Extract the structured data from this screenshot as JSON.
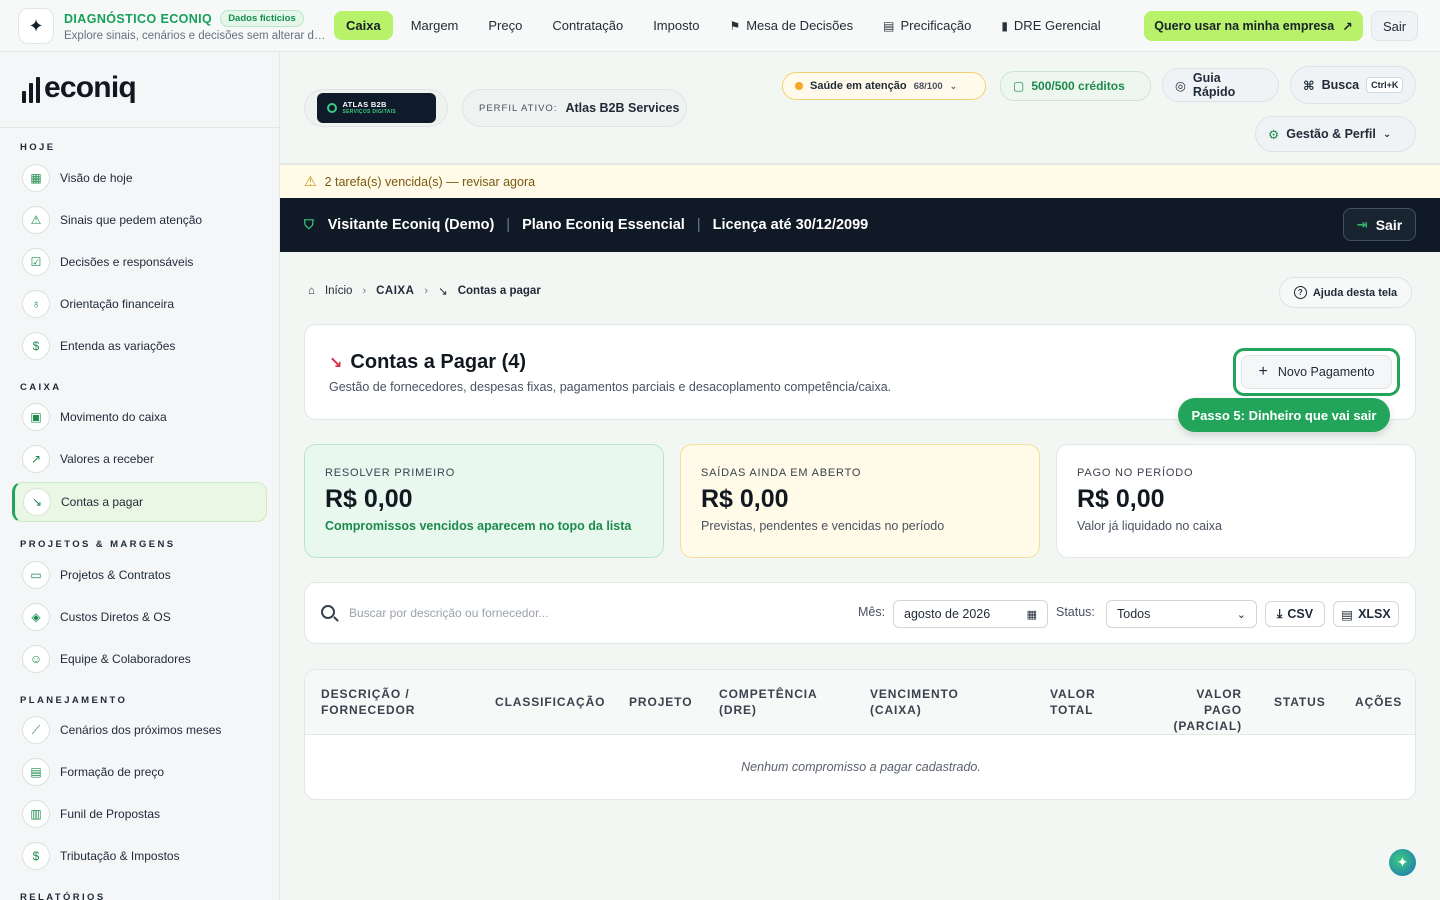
{
  "topbar": {
    "brand_icon": "sparkle-icon",
    "brand_title": "DIAGNÓSTICO ECONIQ",
    "brand_badge": "Dados fictícios",
    "brand_subtitle": "Explore sinais, cenários e decisões sem alterar dados reais",
    "nav": [
      {
        "label": "Caixa",
        "active": true
      },
      {
        "label": "Margem"
      },
      {
        "label": "Preço"
      },
      {
        "label": "Contratação"
      },
      {
        "label": "Imposto"
      },
      {
        "label": "Mesa de Decisões",
        "icon": "flag-icon"
      },
      {
        "label": "Precificação",
        "icon": "calculator-icon"
      },
      {
        "label": "DRE Gerencial",
        "icon": "file-icon"
      }
    ],
    "cta_label": "Quero usar na minha empresa",
    "exit_label": "Sair",
    "accent_color": "#b8f26b"
  },
  "sidebar": {
    "logo_text": "econiq",
    "sections": [
      {
        "label": "HOJE",
        "items": [
          {
            "label": "Visão de hoje",
            "icon": "grid-icon"
          },
          {
            "label": "Sinais que pedem atenção",
            "icon": "warning-icon"
          },
          {
            "label": "Decisões e responsáveis",
            "icon": "check-square-icon"
          },
          {
            "label": "Orientação financeira",
            "icon": "lightbulb-icon"
          },
          {
            "label": "Entenda as variações",
            "icon": "file-dollar-icon"
          }
        ]
      },
      {
        "label": "CAIXA",
        "items": [
          {
            "label": "Movimento do caixa",
            "icon": "wallet-icon"
          },
          {
            "label": "Valores a receber",
            "icon": "trend-up-icon"
          },
          {
            "label": "Contas a pagar",
            "icon": "trend-down-icon",
            "active": true
          }
        ]
      },
      {
        "label": "PROJETOS & MARGENS",
        "items": [
          {
            "label": "Projetos & Contratos",
            "icon": "folder-icon"
          },
          {
            "label": "Custos Diretos & OS",
            "icon": "box-icon"
          },
          {
            "label": "Equipe & Colaboradores",
            "icon": "user-plus-icon"
          }
        ]
      },
      {
        "label": "PLANEJAMENTO",
        "items": [
          {
            "label": "Cenários dos próximos meses",
            "icon": "line-chart-icon"
          },
          {
            "label": "Formação de preço",
            "icon": "calculator-icon"
          },
          {
            "label": "Funil de Propostas",
            "icon": "funnel-icon"
          },
          {
            "label": "Tributação & Impostos",
            "icon": "dollar-doc-icon"
          }
        ]
      },
      {
        "label": "RELATÓRIOS",
        "items": []
      }
    ]
  },
  "header": {
    "org_logo_line1": "ATLAS B2B",
    "org_logo_line2": "SERVIÇOS DIGITAIS",
    "profile_key": "PERFIL ATIVO:",
    "profile_value": "Atlas B2B Services",
    "health_label": "Saúde em atenção",
    "health_score": "68/100",
    "credits_label": "500/500 créditos",
    "guide_label": "Guia Rápido",
    "search_label": "Busca",
    "search_shortcut": "Ctrl+K",
    "manage_label": "Gestão & Perfil"
  },
  "alert": {
    "text": "2 tarefa(s) vencida(s) — revisar agora"
  },
  "license_bar": {
    "user": "Visitante Econiq (Demo)",
    "plan": "Plano Econiq Essencial",
    "license": "Licença até 30/12/2099",
    "exit_label": "Sair"
  },
  "breadcrumb": {
    "home": "Início",
    "section": "CAIXA",
    "current": "Contas a pagar"
  },
  "help_label": "Ajuda desta tela",
  "page": {
    "title": "Contas a Pagar (4)",
    "subtitle": "Gestão de fornecedores, despesas fixas, pagamentos parciais e desacoplamento competência/caixa.",
    "new_button": "Novo Pagamento",
    "tour_step": "Passo 5: Dinheiro que vai sair"
  },
  "kpis": [
    {
      "label": "RESOLVER PRIMEIRO",
      "value": "R$ 0,00",
      "note": "Compromissos vencidos aparecem no topo da lista"
    },
    {
      "label": "SAÍDAS AINDA EM ABERTO",
      "value": "R$ 0,00",
      "note": "Previstas, pendentes e vencidas no período"
    },
    {
      "label": "PAGO NO PERÍODO",
      "value": "R$ 0,00",
      "note": "Valor já liquidado no caixa"
    }
  ],
  "filters": {
    "search_placeholder": "Buscar por descrição ou fornecedor...",
    "month_label": "Mês:",
    "month_value": "agosto de 2026",
    "status_label": "Status:",
    "status_value": "Todos",
    "csv_label": "CSV",
    "xlsx_label": "XLSX"
  },
  "table": {
    "columns": [
      [
        "DESCRIÇÃO /",
        "FORNECEDOR"
      ],
      [
        "CLASSIFICAÇÃO",
        ""
      ],
      [
        "PROJETO",
        ""
      ],
      [
        "COMPETÊNCIA",
        "(DRE)"
      ],
      [
        "VENCIMENTO",
        "(CAIXA)"
      ],
      [
        "VALOR",
        "TOTAL"
      ],
      [
        "VALOR PAGO",
        "(PARCIAL)"
      ],
      [
        "STATUS",
        ""
      ],
      [
        "AÇÕES",
        ""
      ]
    ],
    "empty_message": "Nenhum compromisso a pagar cadastrado."
  }
}
